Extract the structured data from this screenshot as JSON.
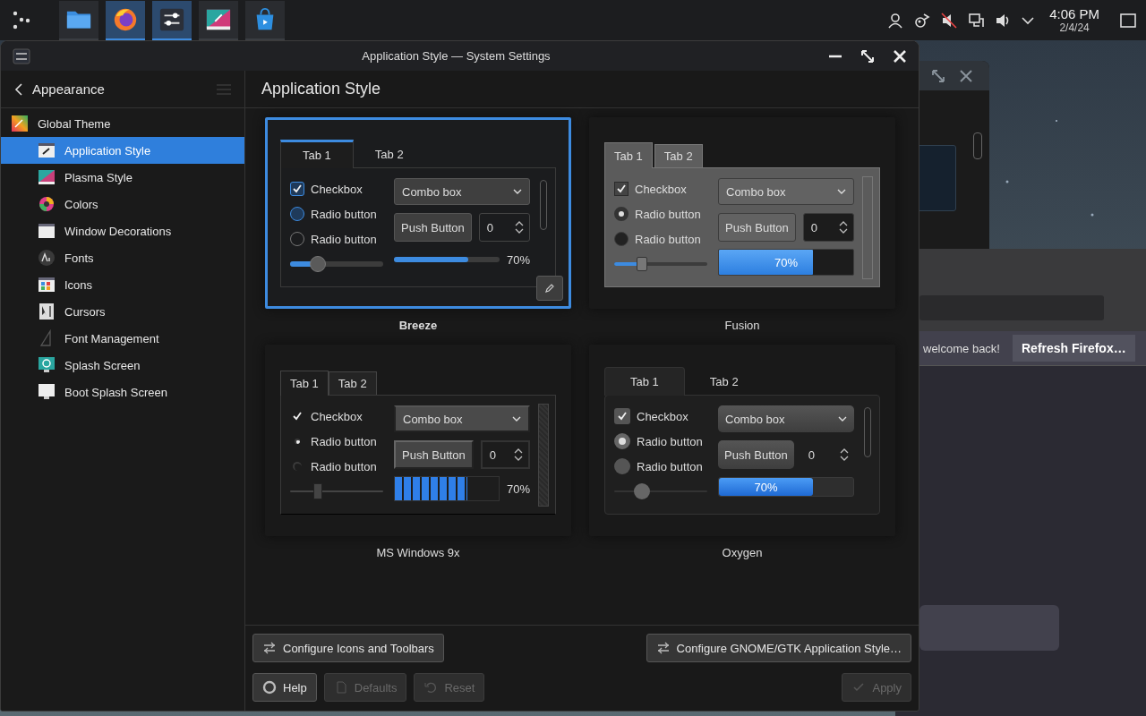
{
  "panel": {
    "clock": {
      "time": "4:06 PM",
      "date": "2/4/24"
    }
  },
  "background": {
    "notification": "welcome back!",
    "refresh_button": "Refresh Firefox…"
  },
  "window": {
    "title": "Application Style — System Settings"
  },
  "sidebar": {
    "back_label": "Appearance",
    "items": [
      {
        "label": "Global Theme",
        "selected": false,
        "children": [
          {
            "label": "Application Style",
            "selected": true
          },
          {
            "label": "Plasma Style",
            "selected": false
          },
          {
            "label": "Colors",
            "selected": false
          },
          {
            "label": "Window Decorations",
            "selected": false
          },
          {
            "label": "Fonts",
            "selected": false
          },
          {
            "label": "Icons",
            "selected": false
          },
          {
            "label": "Cursors",
            "selected": false
          },
          {
            "label": "Font Management",
            "selected": false
          },
          {
            "label": "Splash Screen",
            "selected": false
          },
          {
            "label": "Boot Splash Screen",
            "selected": false
          }
        ]
      }
    ]
  },
  "page": {
    "title": "Application Style",
    "styles": [
      {
        "name": "Breeze",
        "kind": "breeze",
        "selected": true,
        "configurable": true,
        "tabs": [
          {
            "label": "Tab 1",
            "selected": true
          },
          {
            "label": "Tab 2",
            "selected": false
          }
        ],
        "checkbox": {
          "label": "Checkbox",
          "checked": true
        },
        "radios": [
          {
            "label": "Radio button",
            "selected": true
          },
          {
            "label": "Radio button",
            "selected": false
          }
        ],
        "combo": "Combo box",
        "button": "Push Button",
        "spin": "0",
        "slider": {
          "level": 0.3
        },
        "progress": {
          "level": 0.7,
          "reading": "70%"
        }
      },
      {
        "name": "Fusion",
        "kind": "fusion",
        "selected": false,
        "configurable": false,
        "tabs": [
          {
            "label": "Tab 1",
            "selected": true
          },
          {
            "label": "Tab 2",
            "selected": false
          }
        ],
        "checkbox": {
          "label": "Checkbox",
          "checked": true
        },
        "radios": [
          {
            "label": "Radio button",
            "selected": true
          },
          {
            "label": "Radio button",
            "selected": false
          }
        ],
        "combo": "Combo box",
        "button": "Push Button",
        "spin": "0",
        "slider": {
          "level": 0.3
        },
        "progress": {
          "level": 0.7,
          "reading": "70%"
        }
      },
      {
        "name": "MS Windows 9x",
        "kind": "windows9x",
        "selected": false,
        "configurable": false,
        "tabs": [
          {
            "label": "Tab 1",
            "selected": true
          },
          {
            "label": "Tab 2",
            "selected": false
          }
        ],
        "checkbox": {
          "label": "Checkbox",
          "checked": true
        },
        "radios": [
          {
            "label": "Radio button",
            "selected": true
          },
          {
            "label": "Radio button",
            "selected": false
          }
        ],
        "combo": "Combo box",
        "button": "Push Button",
        "spin": "0",
        "slider": {
          "level": 0.3
        },
        "progress": {
          "level": 0.7,
          "reading": "70%"
        }
      },
      {
        "name": "Oxygen",
        "kind": "oxygen",
        "selected": false,
        "configurable": false,
        "tabs": [
          {
            "label": "Tab 1",
            "selected": true
          },
          {
            "label": "Tab 2",
            "selected": false
          }
        ],
        "checkbox": {
          "label": "Checkbox",
          "checked": true
        },
        "radios": [
          {
            "label": "Radio button",
            "selected": true
          },
          {
            "label": "Radio button",
            "selected": false
          }
        ],
        "combo": "Combo box",
        "button": "Push Button",
        "spin": "0",
        "slider": {
          "level": 0.3
        },
        "progress": {
          "level": 0.7,
          "reading": "70%"
        }
      }
    ]
  },
  "buttons": {
    "configure_icons": {
      "label": "Configure Icons and Toolbars",
      "disabled": false
    },
    "configure_gtk": {
      "label": "Configure GNOME/GTK Application Style…",
      "disabled": false
    },
    "help": {
      "label": "Help",
      "disabled": false
    },
    "defaults": {
      "label": "Defaults",
      "disabled": true
    },
    "reset": {
      "label": "Reset",
      "disabled": true
    },
    "apply": {
      "label": "Apply",
      "disabled": true
    }
  }
}
